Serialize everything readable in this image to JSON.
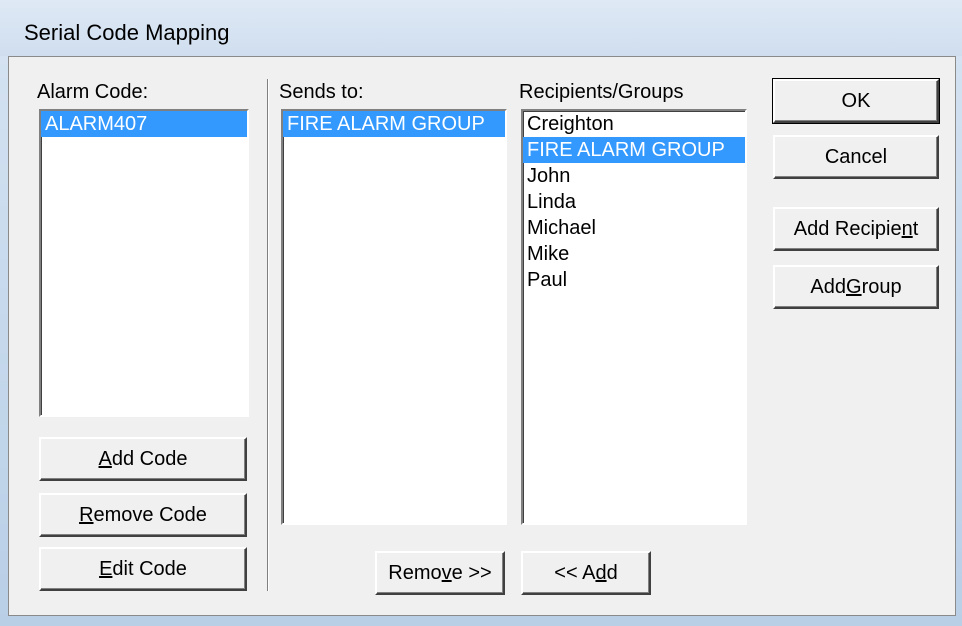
{
  "window": {
    "title": "Serial Code Mapping"
  },
  "alarm_code": {
    "label": "Alarm Code:",
    "items": [
      "ALARM407"
    ],
    "selected_index": 0
  },
  "sends_to": {
    "label": "Sends to:",
    "items": [
      "FIRE ALARM GROUP"
    ],
    "selected_index": 0
  },
  "recipients": {
    "label": "Recipients/Groups",
    "items": [
      "Creighton",
      "FIRE ALARM GROUP",
      "John",
      "Linda",
      "Michael",
      "Mike",
      "Paul"
    ],
    "selected_index": 1
  },
  "buttons": {
    "ok": "OK",
    "cancel": "Cancel",
    "add_recipient": {
      "before": "Add Recipie",
      "mnemonic": "n",
      "after": "t"
    },
    "add_group": {
      "before": "Add ",
      "mnemonic": "G",
      "after": "roup"
    },
    "add_code": {
      "before": "",
      "mnemonic": "A",
      "after": "dd Code"
    },
    "remove_code": {
      "before": "",
      "mnemonic": "R",
      "after": "emove Code"
    },
    "edit_code": {
      "before": "",
      "mnemonic": "E",
      "after": "dit Code"
    },
    "remove": {
      "before": "Remo",
      "mnemonic": "v",
      "after": "e >>"
    },
    "add": {
      "before": "<< A",
      "mnemonic": "d",
      "after": "d"
    }
  }
}
